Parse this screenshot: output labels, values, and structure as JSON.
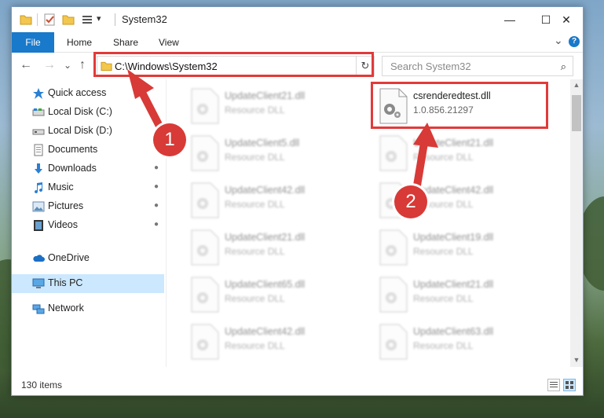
{
  "window": {
    "title": "System32",
    "minimize_glyph": "—",
    "maximize_glyph": "☐",
    "close_glyph": "✕"
  },
  "ribbon": {
    "file_tab": "File",
    "tabs": [
      "Home",
      "Share",
      "View"
    ],
    "collapse_glyph": "⌄",
    "help_glyph": "?"
  },
  "navigation": {
    "back_glyph": "←",
    "forward_glyph": "→",
    "recent_glyph": "⌄",
    "up_glyph": "↑",
    "address": "C:\\Windows\\System32",
    "refresh_glyph": "↻",
    "search_placeholder": "Search System32",
    "search_glyph": "⌕"
  },
  "sidebar": {
    "items": [
      {
        "label": "Quick access",
        "icon": "star-icon",
        "pinned": false
      },
      {
        "label": "Local Disk (C:)",
        "icon": "drive-icon",
        "pinned": false
      },
      {
        "label": "Local Disk (D:)",
        "icon": "drive-icon",
        "pinned": false
      },
      {
        "label": "Documents",
        "icon": "documents-icon",
        "pinned": true
      },
      {
        "label": "Downloads",
        "icon": "download-icon",
        "pinned": true
      },
      {
        "label": "Music",
        "icon": "music-icon",
        "pinned": true
      },
      {
        "label": "Pictures",
        "icon": "pictures-icon",
        "pinned": true
      },
      {
        "label": "Videos",
        "icon": "videos-icon",
        "pinned": true
      },
      {
        "label": "OneDrive",
        "icon": "cloud-icon",
        "pinned": false
      },
      {
        "label": "This PC",
        "icon": "monitor-icon",
        "pinned": false,
        "selected": true
      },
      {
        "label": "Network",
        "icon": "network-icon",
        "pinned": false
      }
    ],
    "pin_glyph": "📌"
  },
  "files": {
    "left_column": [
      {
        "name": "UpdateClient21.dll",
        "type": "Resource DLL"
      },
      {
        "name": "UpdateClient5.dll",
        "type": "Resource DLL"
      },
      {
        "name": "UpdateClient42.dll",
        "type": "Resource DLL"
      },
      {
        "name": "UpdateClient21.dll",
        "type": "Resource DLL"
      },
      {
        "name": "UpdateClient65.dll",
        "type": "Resource DLL"
      },
      {
        "name": "UpdateClient42.dll",
        "type": "Resource DLL"
      }
    ],
    "right_column": [
      {
        "name": "csrenderedtest.dll",
        "type": "1.0.856.21297",
        "highlighted": true
      },
      {
        "name": "UpdateClient21.dll",
        "type": "Resource DLL"
      },
      {
        "name": "UpdateClient42.dll",
        "type": "Resource DLL"
      },
      {
        "name": "UpdateClient19.dll",
        "type": "Resource DLL"
      },
      {
        "name": "UpdateClient21.dll",
        "type": "Resource DLL"
      },
      {
        "name": "UpdateClient63.dll",
        "type": "Resource DLL"
      }
    ]
  },
  "status": {
    "item_count": "130 items"
  },
  "annotations": {
    "marker_1": "1",
    "marker_2": "2",
    "color": "#e23a3a"
  },
  "colors": {
    "accent": "#1979ca",
    "selection": "#cce8ff"
  }
}
